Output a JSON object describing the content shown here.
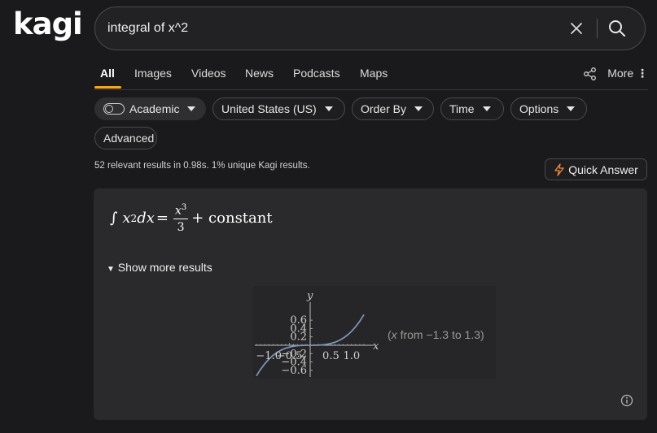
{
  "logo": "kagi",
  "search": {
    "value": "integral of x^2"
  },
  "tabs": [
    "All",
    "Images",
    "Videos",
    "News",
    "Podcasts",
    "Maps"
  ],
  "more_label": "More",
  "filters": {
    "academic": "Academic",
    "region": "United States (US)",
    "order": "Order By",
    "time": "Time",
    "options": "Options",
    "advanced": "Advanced"
  },
  "stats": "52 relevant results in 0.98s. 1% unique Kagi results.",
  "quick_answer": "Quick Answer",
  "answer": {
    "integral_sign": "∫",
    "integrand_base": "x",
    "integrand_exp": "2",
    "dx": "dx",
    "equals": "=",
    "num_base": "x",
    "num_exp": "3",
    "den": "3",
    "tail": "+ constant",
    "show_more": "Show more results",
    "plot_note_var": "x",
    "plot_note_rest": "from −1.3 to 1.3)",
    "plot_note_open": "("
  },
  "chart_data": {
    "type": "line",
    "xlabel": "x",
    "ylabel": "y",
    "xlim": [
      -1.3,
      1.3
    ],
    "ylim": [
      -0.73,
      0.73
    ],
    "xticks": [
      -1.0,
      -0.5,
      0.5,
      1.0
    ],
    "xtick_labels": [
      "−1.0",
      "−0.5",
      "0.5",
      "1.0"
    ],
    "yticks": [
      0.6,
      0.4,
      0.2,
      -0.2,
      -0.4,
      -0.6
    ],
    "ytick_labels": [
      "0.6",
      "0.4",
      "0.2",
      "−0.2",
      "−0.4",
      "−0.6"
    ],
    "function": "x^3/3",
    "x": [
      -1.3,
      -1.2,
      -1.1,
      -1.0,
      -0.9,
      -0.8,
      -0.7,
      -0.6,
      -0.5,
      -0.4,
      -0.3,
      -0.2,
      -0.1,
      0.0,
      0.1,
      0.2,
      0.3,
      0.4,
      0.5,
      0.6,
      0.7,
      0.8,
      0.9,
      1.0,
      1.1,
      1.2,
      1.3
    ],
    "y": [
      -0.732,
      -0.576,
      -0.444,
      -0.333,
      -0.243,
      -0.171,
      -0.114,
      -0.072,
      -0.042,
      -0.021,
      -0.009,
      -0.003,
      0.0,
      0.0,
      0.0,
      0.003,
      0.009,
      0.021,
      0.042,
      0.072,
      0.114,
      0.171,
      0.243,
      0.333,
      0.444,
      0.576,
      0.732
    ],
    "color": "#7d93b8"
  }
}
